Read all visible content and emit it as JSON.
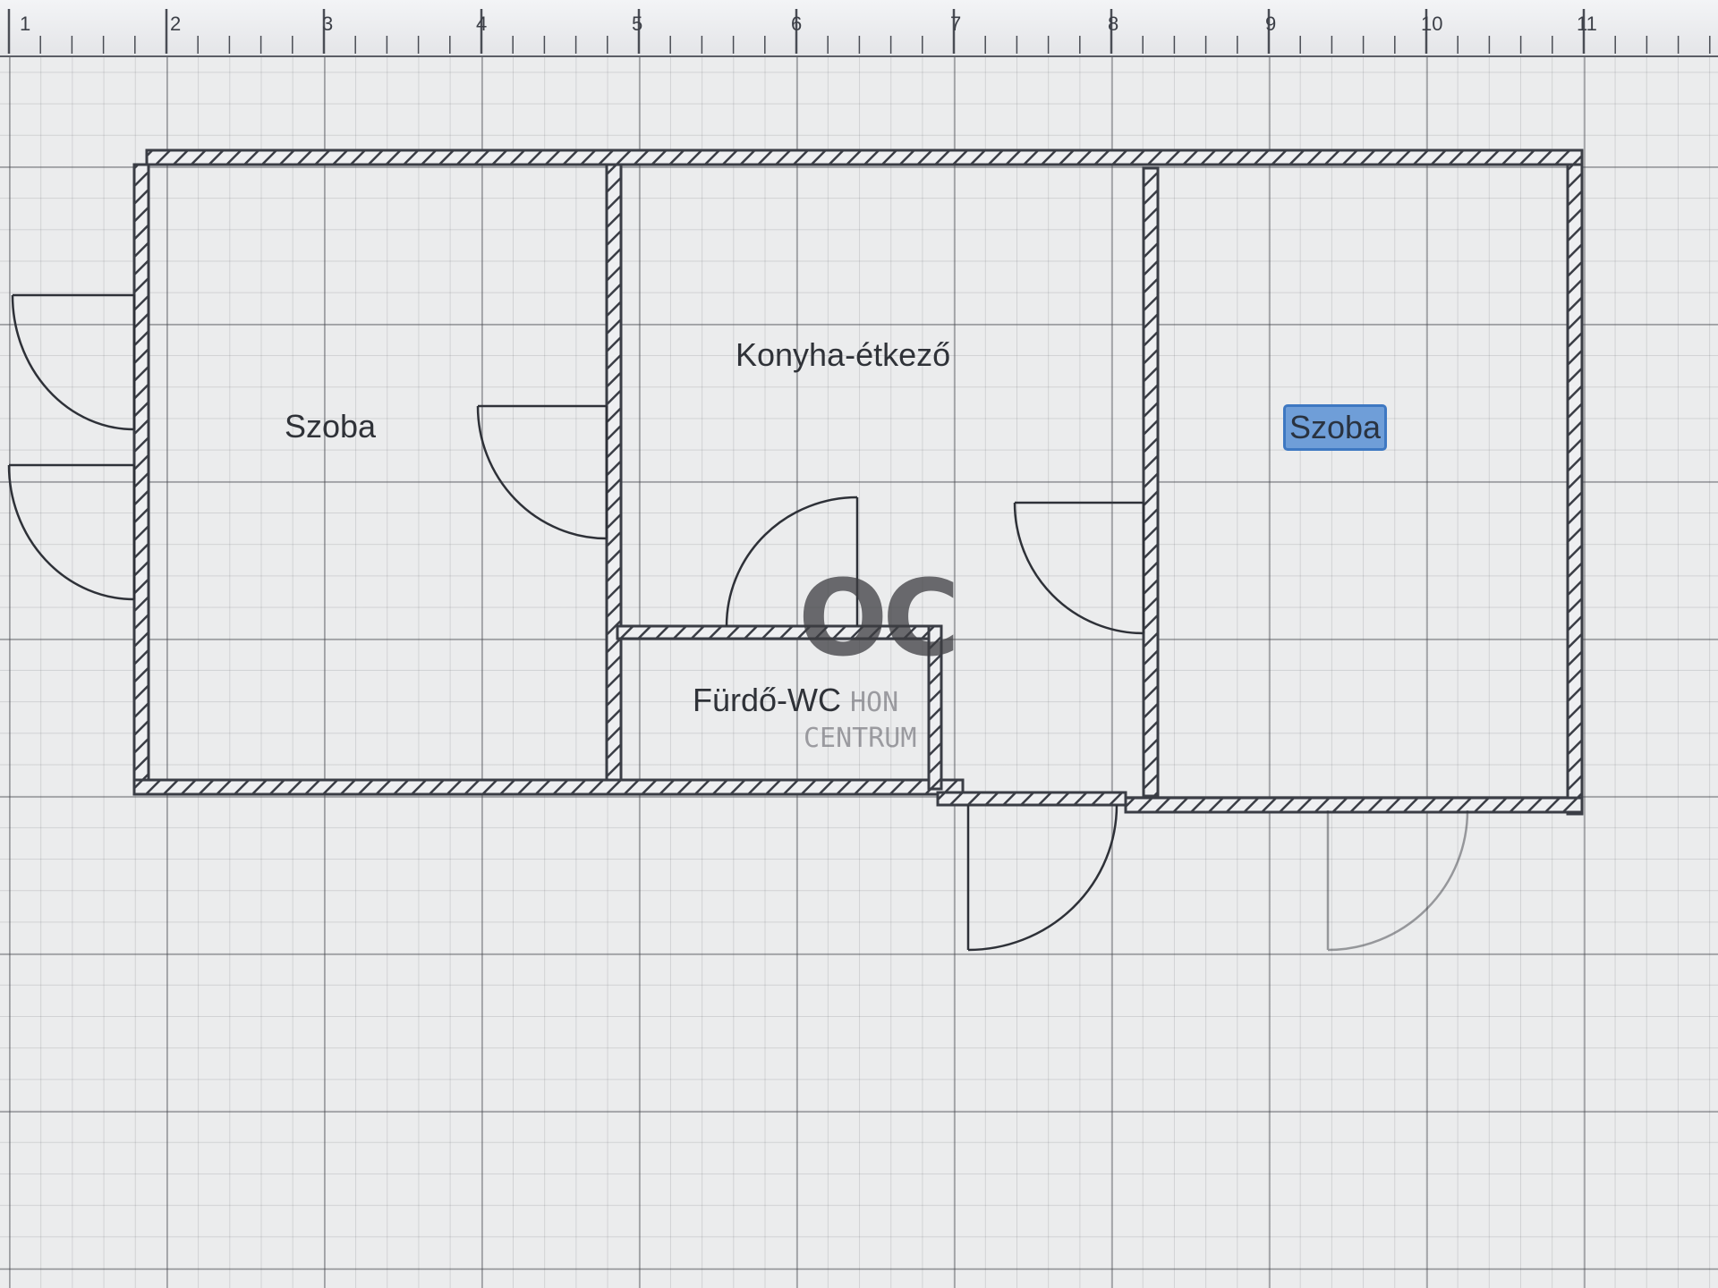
{
  "ruler": {
    "labels": [
      "1",
      "2",
      "3",
      "4",
      "5",
      "6",
      "7",
      "8",
      "9",
      "10",
      "11"
    ]
  },
  "rooms": {
    "left": "Szoba",
    "kitchen": "Konyha-étkező",
    "bath": "Fürdő-WC",
    "right": "Szoba"
  },
  "selection": {
    "selected_room": "right"
  },
  "watermark": {
    "letters": "OC",
    "line1": "HON",
    "line2": "CENTRUM"
  },
  "colors": {
    "wall": "#3a3d45",
    "selection": "#6f9ed8",
    "grid": "#46484e"
  },
  "icons": {
    "door": "door-swing-icon"
  }
}
